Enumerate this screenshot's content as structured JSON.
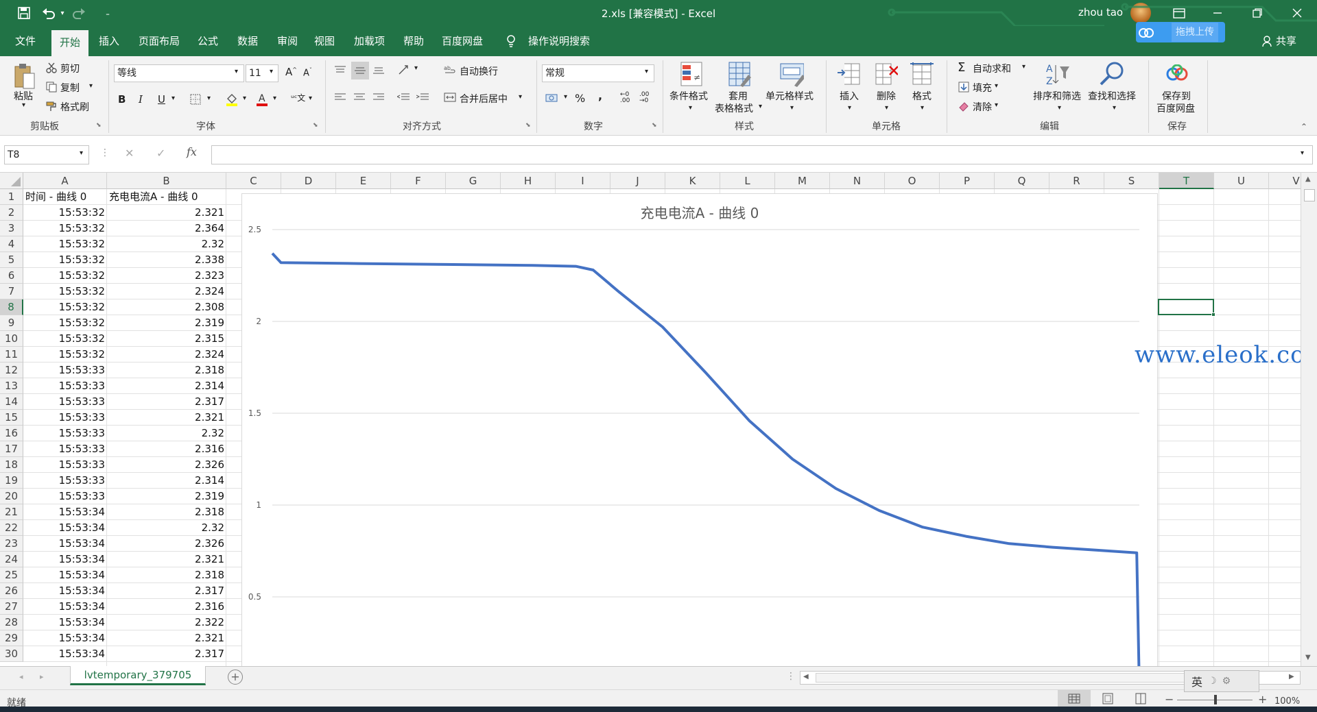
{
  "titlebar": {
    "title": "2.xls  [兼容模式]  -  Excel",
    "user": "zhou tao",
    "upload_label": "拖拽上传"
  },
  "tabs": [
    "文件",
    "开始",
    "插入",
    "页面布局",
    "公式",
    "数据",
    "审阅",
    "视图",
    "加载项",
    "帮助",
    "百度网盘"
  ],
  "search_hint": "操作说明搜索",
  "share_label": "共享",
  "ribbon": {
    "clipboard": {
      "paste": "粘贴",
      "cut": "剪切",
      "copy": "复制",
      "format_painter": "格式刷",
      "label": "剪贴板"
    },
    "font": {
      "name": "等线",
      "size": "11",
      "label": "字体",
      "bold": "B",
      "italic": "I",
      "underline": "U"
    },
    "alignment": {
      "wrap": "自动换行",
      "merge": "合并后居中",
      "label": "对齐方式"
    },
    "number": {
      "format": "常规",
      "label": "数字",
      "percent": "%",
      "comma": ","
    },
    "styles": {
      "conditional": "条件格式",
      "table1": "套用",
      "table2": "表格格式",
      "cell_styles": "单元格样式",
      "label": "样式"
    },
    "cells": {
      "insert": "插入",
      "delete": "删除",
      "format": "格式",
      "label": "单元格"
    },
    "editing": {
      "autosum": "自动求和",
      "fill": "填充",
      "clear": "清除",
      "sort": "排序和筛选",
      "find": "查找和选择",
      "label": "编辑"
    },
    "save": {
      "line1": "保存到",
      "line2": "百度网盘",
      "label": "保存"
    }
  },
  "formula": {
    "name_box": "T8",
    "fx": "fx",
    "value": ""
  },
  "columns": [
    "A",
    "B",
    "C",
    "D",
    "E",
    "F",
    "G",
    "H",
    "I",
    "J",
    "K",
    "L",
    "M",
    "N",
    "O",
    "P",
    "Q",
    "R",
    "S",
    "T",
    "U",
    "V"
  ],
  "selected_column": "T",
  "selected_row": "8",
  "header_row": {
    "a": "时间 - 曲线 0",
    "b": "充电电流A - 曲线 0"
  },
  "rows": [
    {
      "n": "2",
      "t": "15:53:32",
      "v": "2.321"
    },
    {
      "n": "3",
      "t": "15:53:32",
      "v": "2.364"
    },
    {
      "n": "4",
      "t": "15:53:32",
      "v": "2.32"
    },
    {
      "n": "5",
      "t": "15:53:32",
      "v": "2.338"
    },
    {
      "n": "6",
      "t": "15:53:32",
      "v": "2.323"
    },
    {
      "n": "7",
      "t": "15:53:32",
      "v": "2.324"
    },
    {
      "n": "8",
      "t": "15:53:32",
      "v": "2.308"
    },
    {
      "n": "9",
      "t": "15:53:32",
      "v": "2.319"
    },
    {
      "n": "10",
      "t": "15:53:32",
      "v": "2.315"
    },
    {
      "n": "11",
      "t": "15:53:32",
      "v": "2.324"
    },
    {
      "n": "12",
      "t": "15:53:33",
      "v": "2.318"
    },
    {
      "n": "13",
      "t": "15:53:33",
      "v": "2.314"
    },
    {
      "n": "14",
      "t": "15:53:33",
      "v": "2.317"
    },
    {
      "n": "15",
      "t": "15:53:33",
      "v": "2.321"
    },
    {
      "n": "16",
      "t": "15:53:33",
      "v": "2.32"
    },
    {
      "n": "17",
      "t": "15:53:33",
      "v": "2.316"
    },
    {
      "n": "18",
      "t": "15:53:33",
      "v": "2.326"
    },
    {
      "n": "19",
      "t": "15:53:33",
      "v": "2.314"
    },
    {
      "n": "20",
      "t": "15:53:33",
      "v": "2.319"
    },
    {
      "n": "21",
      "t": "15:53:34",
      "v": "2.318"
    },
    {
      "n": "22",
      "t": "15:53:34",
      "v": "2.32"
    },
    {
      "n": "23",
      "t": "15:53:34",
      "v": "2.326"
    },
    {
      "n": "24",
      "t": "15:53:34",
      "v": "2.321"
    },
    {
      "n": "25",
      "t": "15:53:34",
      "v": "2.318"
    },
    {
      "n": "26",
      "t": "15:53:34",
      "v": "2.317"
    },
    {
      "n": "27",
      "t": "15:53:34",
      "v": "2.316"
    },
    {
      "n": "28",
      "t": "15:53:34",
      "v": "2.322"
    },
    {
      "n": "29",
      "t": "15:53:34",
      "v": "2.321"
    },
    {
      "n": "30",
      "t": "15:53:34",
      "v": "2.317"
    }
  ],
  "row1_num": "1",
  "chart_data": {
    "type": "line",
    "title": "充电电流A - 曲线 0",
    "ylim": [
      0,
      2.5
    ],
    "yticks": [
      "2.5",
      "2",
      "1.5",
      "1",
      "0.5"
    ],
    "series": [
      {
        "color": "#4472c4",
        "x": [
          0.0,
          0.01,
          0.1,
          0.2,
          0.3,
          0.35,
          0.37,
          0.4,
          0.45,
          0.5,
          0.55,
          0.6,
          0.65,
          0.7,
          0.75,
          0.8,
          0.85,
          0.9,
          0.95,
          0.997,
          1.0
        ],
        "values": [
          2.37,
          2.32,
          2.315,
          2.31,
          2.305,
          2.3,
          2.28,
          2.16,
          1.97,
          1.72,
          1.46,
          1.25,
          1.09,
          0.97,
          0.88,
          0.83,
          0.79,
          0.77,
          0.755,
          0.74,
          0.0
        ]
      }
    ]
  },
  "watermark": "www.eleok.com",
  "sheet_tab": "lvtemporary_379705",
  "status": {
    "ready": "就绪",
    "zoom": "100%"
  },
  "ime": "英"
}
